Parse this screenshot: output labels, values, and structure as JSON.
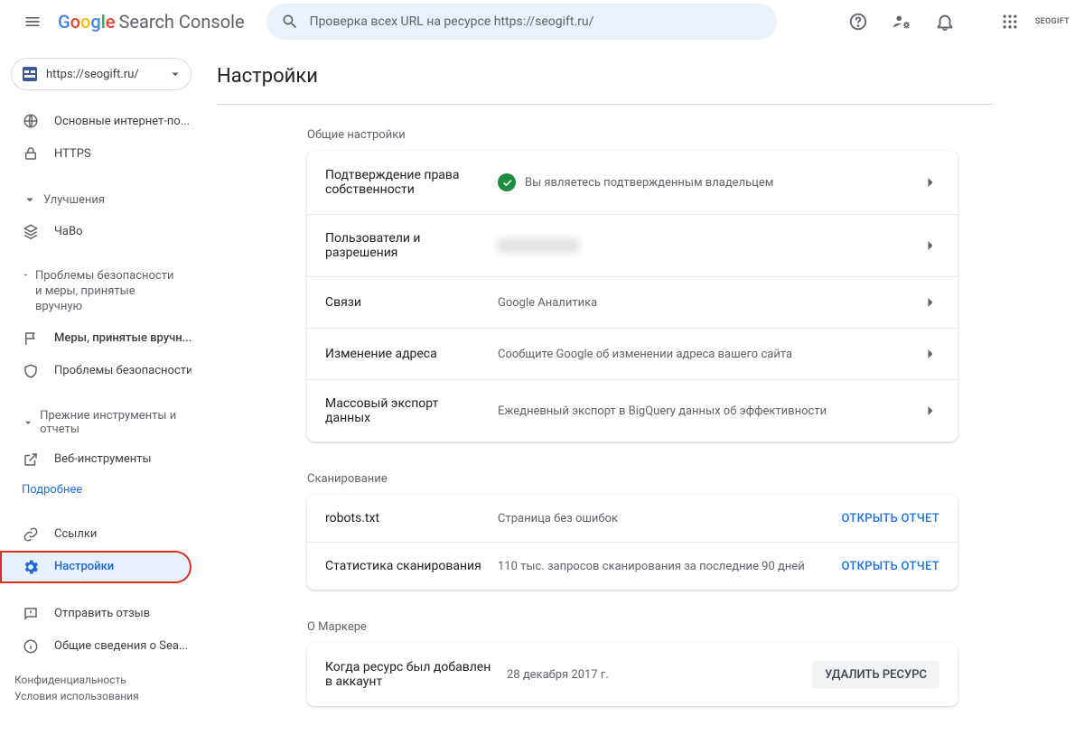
{
  "app": {
    "product": "Search Console"
  },
  "search": {
    "placeholder": "Проверка всех URL на ресурсе https://seogift.ru/"
  },
  "brandTag": "SEOGIFT",
  "property": {
    "url": "https://seogift.ru/"
  },
  "sidebar": {
    "top": [
      {
        "label": "Основные интернет-по...",
        "icon": "globe"
      },
      {
        "label": "HTTPS",
        "icon": "lock"
      }
    ],
    "group_enhancements": {
      "title": "Улучшения",
      "items": [
        {
          "label": "ЧаВо",
          "icon": "layers"
        }
      ]
    },
    "group_security": {
      "title": "Проблемы безопасности и меры, принятые вручную",
      "items": [
        {
          "label": "Меры, принятые вручн...",
          "icon": "flag",
          "bold": true
        },
        {
          "label": "Проблемы безопасности",
          "icon": "shield"
        }
      ]
    },
    "group_legacy": {
      "title": "Прежние инструменты и отчеты",
      "items": [
        {
          "label": "Веб-инструменты",
          "icon": "open"
        }
      ],
      "more": "Подробнее"
    },
    "bottom": [
      {
        "label": "Ссылки",
        "icon": "link"
      },
      {
        "label": "Настройки",
        "icon": "gear",
        "active": true
      }
    ],
    "footer": [
      {
        "label": "Отправить отзыв",
        "icon": "feedback"
      },
      {
        "label": "Общие сведения о Sea...",
        "icon": "info"
      }
    ]
  },
  "legal": {
    "privacy": "Конфиденциальность",
    "terms": "Условия использования"
  },
  "page": {
    "title": "Настройки",
    "sections": {
      "general": {
        "title": "Общие настройки",
        "rows": [
          {
            "label": "Подтверждение права собственности",
            "value": "Вы являетесь подтвержденным владельцем",
            "verified": true,
            "chevron": true
          },
          {
            "label": "Пользователи и разрешения",
            "blurred": true,
            "chevron": true
          },
          {
            "label": "Связи",
            "value": "Google Аналитика",
            "chevron": true
          },
          {
            "label": "Изменение адреса",
            "value": "Сообщите Google об изменении адреса вашего сайта",
            "chevron": true
          },
          {
            "label": "Массовый экспорт данных",
            "value": "Ежедневный экспорт в BigQuery данных об эффективности",
            "chevron": true
          }
        ]
      },
      "crawling": {
        "title": "Сканирование",
        "open_report": "ОТКРЫТЬ ОТЧЕТ",
        "rows": [
          {
            "label": "robots.txt",
            "value": "Страница без ошибок"
          },
          {
            "label": "Статистика сканирования",
            "value": "110 тыс. запросов сканирования за последние 90 дней"
          }
        ]
      },
      "about": {
        "title": "О Маркере",
        "rows": [
          {
            "label": "Когда ресурс был добавлен в аккаунт",
            "value": "28 декабря 2017 г.",
            "action": "УДАЛИТЬ РЕСУРС"
          }
        ]
      }
    }
  }
}
